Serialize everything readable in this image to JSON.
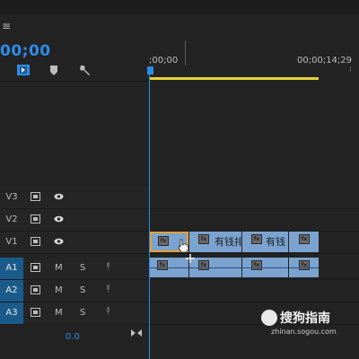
{
  "sequence": {
    "timecode": "00;00",
    "ruler": {
      "start_label": ";00;00",
      "end_label": "00;00;14;29"
    }
  },
  "toolbar": {
    "icons": [
      "menu-icon",
      "snap-icon",
      "marker-icon",
      "wrench-icon"
    ]
  },
  "tracks": {
    "video": [
      {
        "name": "V3",
        "selected": false
      },
      {
        "name": "V2",
        "selected": false
      },
      {
        "name": "V1",
        "selected": false
      }
    ],
    "audio": [
      {
        "name": "A1",
        "selected": true,
        "mute": "M",
        "solo": "S"
      },
      {
        "name": "A2",
        "selected": true,
        "mute": "M",
        "solo": "S"
      },
      {
        "name": "A3",
        "selected": true,
        "mute": "M",
        "solo": "S"
      }
    ]
  },
  "clips": {
    "video": [
      {
        "title": ""
      },
      {
        "title": "有钱排"
      },
      {
        "title": "有钱"
      },
      {
        "title": ""
      }
    ],
    "fx_label": "fx"
  },
  "footer": {
    "value": "0.0"
  },
  "watermark": {
    "text": "搜狗指南",
    "url": "zhinan.sogou.com"
  },
  "colors": {
    "accent": "#2d8ceb",
    "clip": "#7ba3d0",
    "workarea": "#e6d23a",
    "selection": "#e8a032"
  }
}
